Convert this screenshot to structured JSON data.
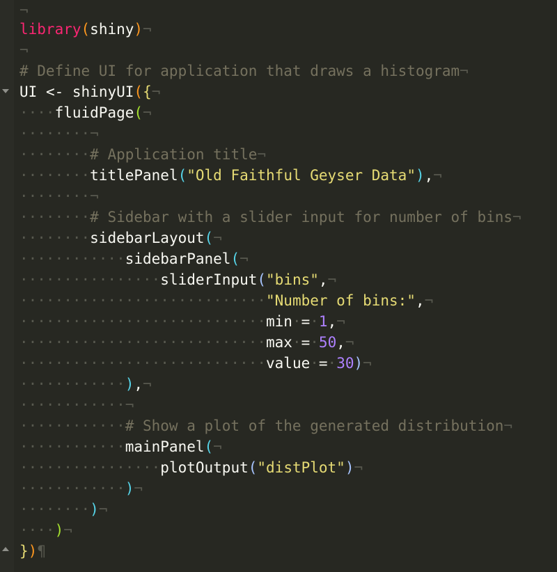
{
  "theme": {
    "background": "#272822",
    "invisibles": "#58594f",
    "comment": "#75715e",
    "string": "#e6db74",
    "number": "#ae81ff",
    "function": "#f92672",
    "text": "#f8f8f2"
  },
  "markers": {
    "eol": "¬",
    "eof": "¶",
    "space": "·"
  },
  "code": {
    "l1_fn": "library",
    "l1_open": "(",
    "l1_arg": "shiny",
    "l1_close": ")",
    "l3_comment": "# Define UI for application that draws a histogram",
    "l4_var": "UI",
    "l4_assign": "<-",
    "l4_fn": "shinyUI",
    "l4_open": "(",
    "l4_brace": "{",
    "l5_fn": "fluidPage",
    "l5_open": "(",
    "l7_comment": "# Application title",
    "l8_fn": "titlePanel",
    "l8_open": "(",
    "l8_str": "\"Old Faithful Geyser Data\"",
    "l8_close": ")",
    "l8_comma": ",",
    "l10_comment": "# Sidebar with a slider input for number of bins",
    "l11_fn": "sidebarLayout",
    "l11_open": "(",
    "l12_fn": "sidebarPanel",
    "l12_open": "(",
    "l13_fn": "sliderInput",
    "l13_open": "(",
    "l13_str": "\"bins\"",
    "l13_comma": ",",
    "l14_str": "\"Number of bins:\"",
    "l14_comma": ",",
    "l15_key": "min",
    "l15_eq": "=",
    "l15_val": "1",
    "l15_comma": ",",
    "l16_key": "max",
    "l16_eq": "=",
    "l16_val": "50",
    "l16_comma": ",",
    "l17_key": "value",
    "l17_eq": "=",
    "l17_val": "30",
    "l17_close": ")",
    "l18_close": ")",
    "l18_comma": ",",
    "l20_comment": "# Show a plot of the generated distribution",
    "l21_fn": "mainPanel",
    "l21_open": "(",
    "l22_fn": "plotOutput",
    "l22_open": "(",
    "l22_str": "\"distPlot\"",
    "l22_close": ")",
    "l23_close": ")",
    "l24_close": ")",
    "l25_close": ")",
    "l26_brace": "}",
    "l26_close": ")"
  }
}
